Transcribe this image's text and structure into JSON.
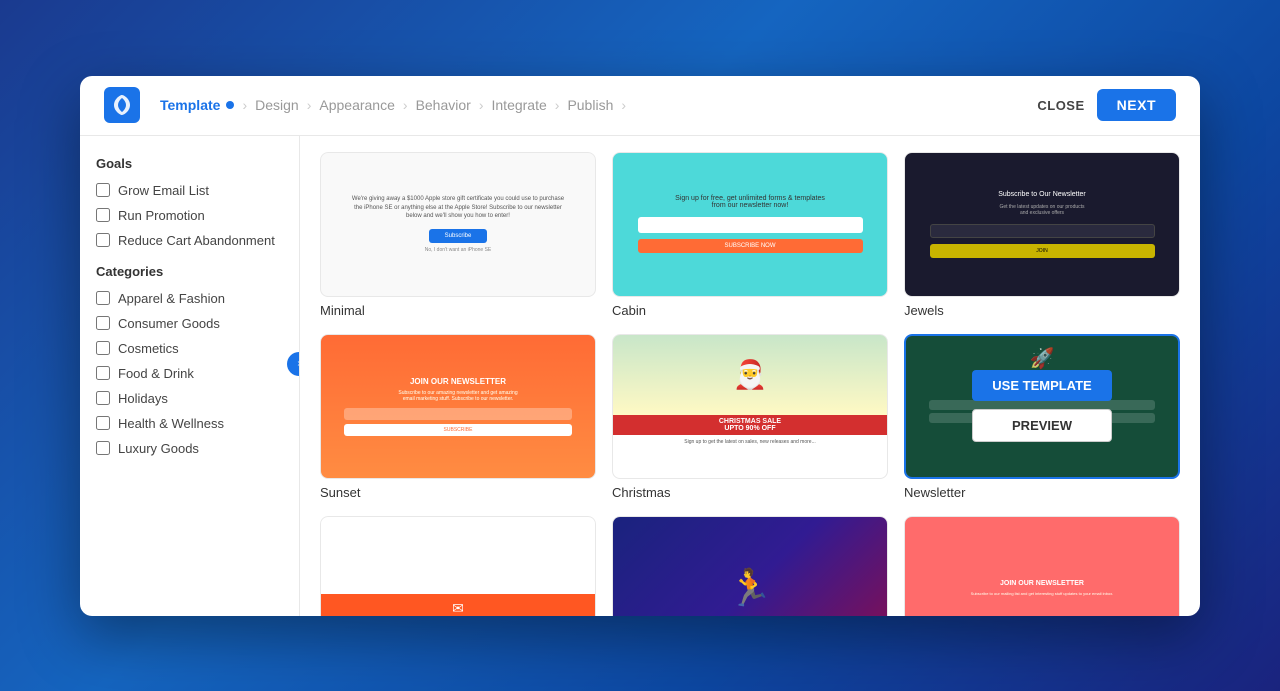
{
  "header": {
    "logo_alt": "Sumo logo",
    "steps": [
      {
        "label": "Template",
        "active": true,
        "has_dot": true
      },
      {
        "label": "Design",
        "active": false,
        "has_dot": false
      },
      {
        "label": "Appearance",
        "active": false,
        "has_dot": false
      },
      {
        "label": "Behavior",
        "active": false,
        "has_dot": false
      },
      {
        "label": "Integrate",
        "active": false,
        "has_dot": false
      },
      {
        "label": "Publish",
        "active": false,
        "has_dot": false
      }
    ],
    "close_label": "CLOSE",
    "next_label": "NEXT"
  },
  "sidebar": {
    "goals_title": "Goals",
    "goals": [
      {
        "label": "Grow Email List",
        "checked": false
      },
      {
        "label": "Run Promotion",
        "checked": false
      },
      {
        "label": "Reduce Cart Abandonment",
        "checked": false
      }
    ],
    "categories_title": "Categories",
    "categories": [
      {
        "label": "Apparel & Fashion",
        "checked": false
      },
      {
        "label": "Consumer Goods",
        "checked": false
      },
      {
        "label": "Cosmetics",
        "checked": false
      },
      {
        "label": "Food & Drink",
        "checked": false
      },
      {
        "label": "Holidays",
        "checked": false
      },
      {
        "label": "Health & Wellness",
        "checked": false
      },
      {
        "label": "Luxury Goods",
        "checked": false
      }
    ],
    "toggle_icon": "›"
  },
  "templates": [
    {
      "name": "Minimal",
      "type": "minimal",
      "hovered": false
    },
    {
      "name": "Cabin",
      "type": "cabin",
      "hovered": false
    },
    {
      "name": "Jewels",
      "type": "jewels",
      "hovered": false
    },
    {
      "name": "Sunset",
      "type": "sunset",
      "hovered": false
    },
    {
      "name": "Christmas",
      "type": "christmas",
      "hovered": false
    },
    {
      "name": "Newsletter",
      "type": "newsletter",
      "hovered": true
    },
    {
      "name": "",
      "type": "bottom1",
      "hovered": false
    },
    {
      "name": "",
      "type": "sports",
      "hovered": false
    },
    {
      "name": "",
      "type": "pink",
      "hovered": false
    }
  ],
  "overlay": {
    "use_template_label": "USE TEMPLATE",
    "preview_label": "PREVIEW"
  }
}
